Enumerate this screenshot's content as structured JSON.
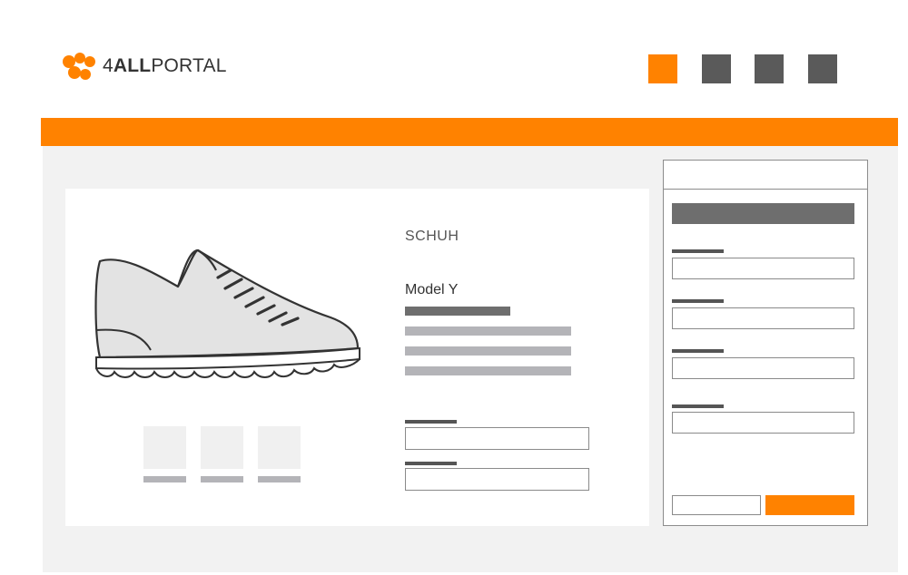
{
  "header": {
    "logo_prefix": "4",
    "logo_bold": "ALL",
    "logo_suffix": "PORTAL",
    "nav_squares": [
      {
        "color": "#ff8200"
      },
      {
        "color": "#5a5a5a"
      },
      {
        "color": "#5a5a5a"
      },
      {
        "color": "#5a5a5a"
      }
    ]
  },
  "colors": {
    "accent": "#ff8200",
    "dark_gray": "#5a5a5a",
    "background": "#f2f2f2"
  },
  "product": {
    "brand": "SCHUH",
    "model": "Model Y",
    "image_icon": "sneaker-icon",
    "thumbnail_count": 3
  }
}
